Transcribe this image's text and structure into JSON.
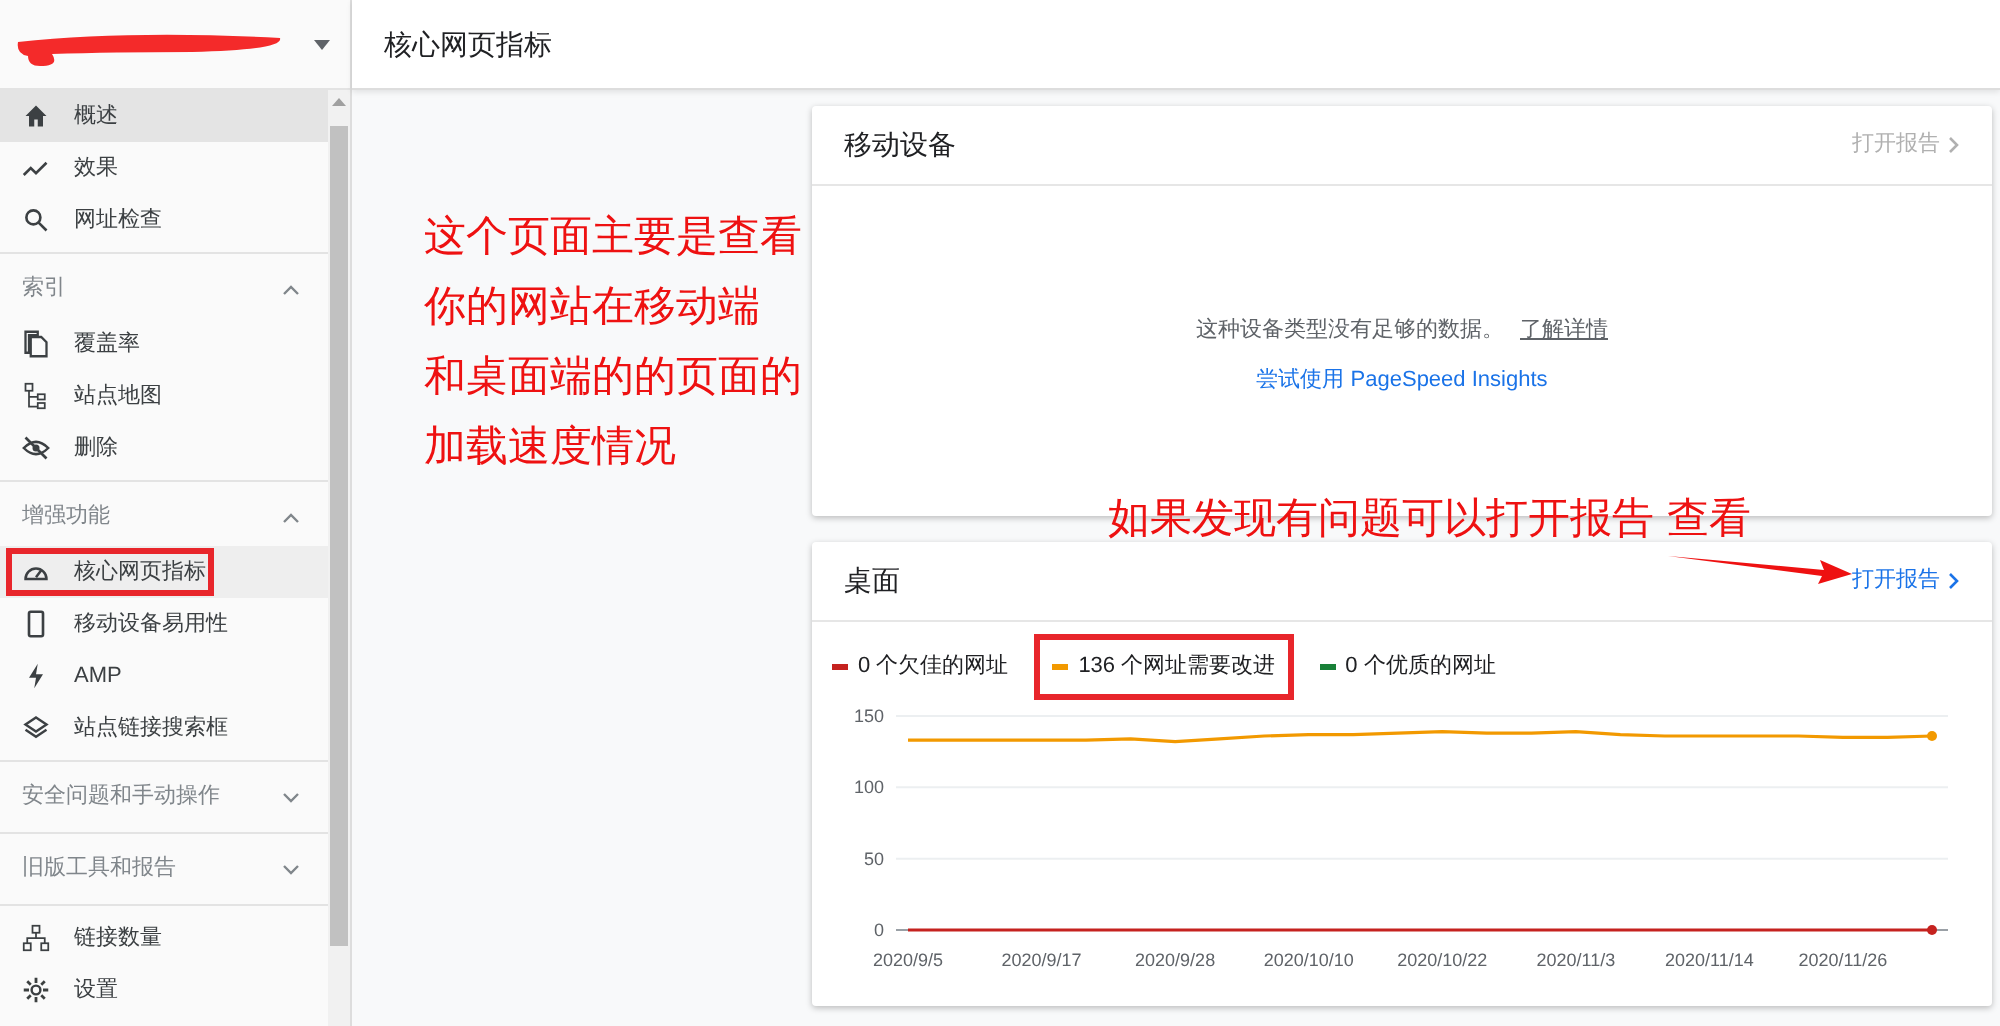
{
  "page_title": "核心网页指标",
  "sidebar": {
    "items": [
      {
        "kind": "item",
        "label": "概述",
        "selected": false,
        "hovered": true,
        "highlighted": false
      },
      {
        "kind": "item",
        "label": "效果",
        "selected": false,
        "hovered": false,
        "highlighted": false
      },
      {
        "kind": "item",
        "label": "网址检查",
        "selected": false,
        "hovered": false,
        "highlighted": false
      },
      {
        "kind": "section",
        "label": "索引",
        "expanded": true,
        "children": [
          {
            "kind": "item",
            "label": "覆盖率",
            "selected": false,
            "hovered": false,
            "highlighted": false
          },
          {
            "kind": "item",
            "label": "站点地图",
            "selected": false,
            "hovered": false,
            "highlighted": false
          },
          {
            "kind": "item",
            "label": "删除",
            "selected": false,
            "hovered": false,
            "highlighted": false
          }
        ]
      },
      {
        "kind": "section",
        "label": "增强功能",
        "expanded": true,
        "children": [
          {
            "kind": "item",
            "label": "核心网页指标",
            "selected": true,
            "hovered": false,
            "highlighted": true
          },
          {
            "kind": "item",
            "label": "移动设备易用性",
            "selected": false,
            "hovered": false,
            "highlighted": false
          },
          {
            "kind": "item",
            "label": "AMP",
            "selected": false,
            "hovered": false,
            "highlighted": false
          },
          {
            "kind": "item",
            "label": "站点链接搜索框",
            "selected": false,
            "hovered": false,
            "highlighted": false
          }
        ]
      },
      {
        "kind": "section",
        "label": "安全问题和手动操作",
        "expanded": false
      },
      {
        "kind": "section",
        "label": "旧版工具和报告",
        "expanded": false
      },
      {
        "kind": "item",
        "label": "链接数量",
        "selected": false,
        "hovered": false,
        "highlighted": false
      },
      {
        "kind": "item",
        "label": "设置",
        "selected": false,
        "hovered": false,
        "highlighted": false
      }
    ]
  },
  "annotations": {
    "side_note": [
      "这个页面主要是查看",
      "你的网站在移动端",
      "和桌面端的的页面的",
      "加载速度情况"
    ],
    "card_note": "如果发现有问题可以打开报告 查看"
  },
  "mobile_card": {
    "title": "移动设备",
    "open_report": {
      "label": "打开报告",
      "disabled": true
    },
    "message": "这种设备类型没有足够的数据。",
    "learn_more": "了解详情",
    "pagespeed_link": "尝试使用 PageSpeed Insights"
  },
  "desktop_card": {
    "title": "桌面",
    "open_report": {
      "label": "打开报告",
      "disabled": false
    },
    "legend_highlights": [
      false,
      true,
      false
    ],
    "chart_data": {
      "type": "line",
      "categories": [
        "2020/9/5",
        null,
        null,
        "2020/9/17",
        null,
        null,
        "2020/9/28",
        null,
        null,
        "2020/10/10",
        null,
        null,
        "2020/10/22",
        null,
        null,
        "2020/11/3",
        null,
        null,
        "2020/11/14",
        null,
        null,
        "2020/11/26",
        null,
        null
      ],
      "series": [
        {
          "name": "0 个欠佳的网址",
          "color": "#c5221f",
          "values": [
            0,
            0,
            0,
            0,
            0,
            0,
            0,
            0,
            0,
            0,
            0,
            0,
            0,
            0,
            0,
            0,
            0,
            0,
            0,
            0,
            0,
            0,
            0,
            0
          ]
        },
        {
          "name": "136 个网址需要改进",
          "color": "#f29900",
          "values": [
            133,
            133,
            133,
            133,
            133,
            134,
            132,
            134,
            136,
            137,
            137,
            138,
            139,
            138,
            138,
            139,
            137,
            136,
            136,
            136,
            136,
            135,
            135,
            136
          ]
        },
        {
          "name": "0 个优质的网址",
          "color": "#188038",
          "values": [
            null,
            null,
            null,
            null,
            null,
            null,
            null,
            null,
            null,
            null,
            null,
            null,
            null,
            null,
            null,
            null,
            null,
            null,
            null,
            null,
            null,
            null,
            null,
            null
          ]
        }
      ],
      "ylim": [
        0,
        150
      ],
      "yticks": [
        0,
        50,
        100,
        150
      ]
    }
  }
}
